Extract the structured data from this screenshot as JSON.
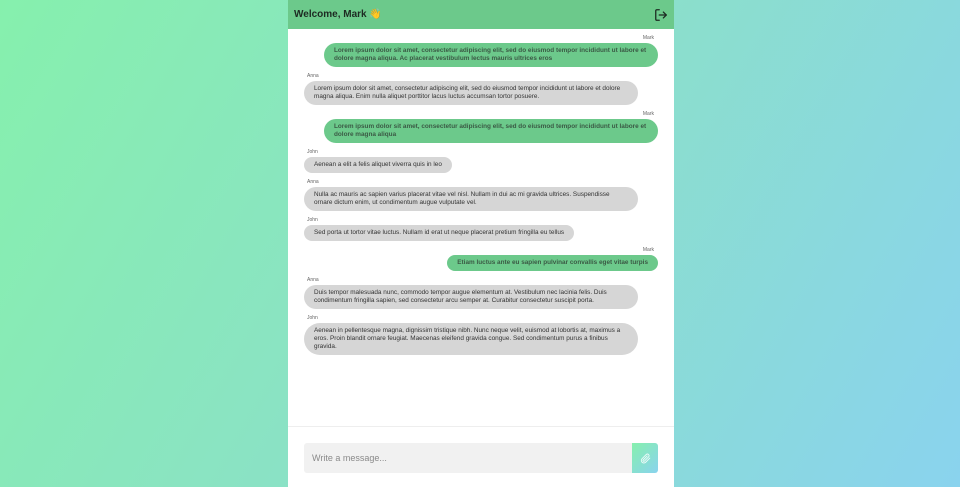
{
  "header": {
    "title": "Welcome, Mark 👋",
    "logout_icon": "logout-icon"
  },
  "messages": [
    {
      "sender": "Mark",
      "mine": true,
      "text": "Lorem ipsum dolor sit amet, consectetur adipiscing elit, sed do eiusmod tempor incididunt ut labore et dolore magna aliqua. Ac placerat vestibulum lectus mauris ultrices eros"
    },
    {
      "sender": "Anna",
      "mine": false,
      "text": "Lorem ipsum dolor sit amet, consectetur adipiscing elit, sed do eiusmod tempor incididunt ut labore et dolore magna aliqua. Enim nulla aliquet porttitor lacus luctus accumsan tortor posuere."
    },
    {
      "sender": "Mark",
      "mine": true,
      "text": "Lorem ipsum dolor sit amet, consectetur adipiscing elit, sed do eiusmod tempor incididunt ut labore et dolore magna aliqua"
    },
    {
      "sender": "John",
      "mine": false,
      "text": "Aenean a elit a felis aliquet viverra quis in leo"
    },
    {
      "sender": "Anna",
      "mine": false,
      "text": "Nulla ac mauris ac sapien varius placerat vitae vel nisl. Nullam in dui ac mi gravida ultrices. Suspendisse ornare dictum enim, ut condimentum augue vulputate vel."
    },
    {
      "sender": "John",
      "mine": false,
      "text": "Sed porta ut tortor vitae luctus. Nullam id erat ut neque placerat pretium fringilla eu tellus"
    },
    {
      "sender": "Mark",
      "mine": true,
      "text": "Etiam luctus ante eu sapien pulvinar convallis eget vitae turpis"
    },
    {
      "sender": "Anna",
      "mine": false,
      "text": "Duis tempor malesuada nunc, commodo tempor augue elementum at. Vestibulum nec lacinia felis. Duis condimentum fringilla sapien, sed consectetur arcu semper at. Curabitur consectetur suscipit porta."
    },
    {
      "sender": "John",
      "mine": false,
      "text": "Aenean in pellentesque magna, dignissim tristique nibh. Nunc neque velit, euismod at lobortis at, maximus a eros. Proin blandit ornare feugiat. Maecenas eleifend gravida congue. Sed condimentum purus a finibus gravida."
    }
  ],
  "composer": {
    "placeholder": "Write a message...",
    "value": "",
    "send_icon": "send-icon"
  }
}
